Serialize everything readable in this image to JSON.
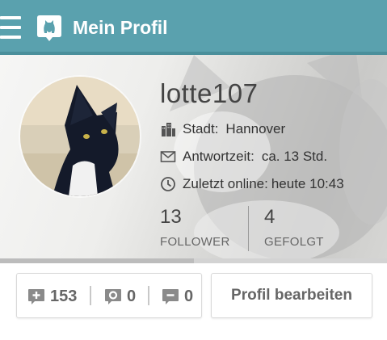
{
  "appbar": {
    "title": "Mein Profil",
    "background": "#5aa1ae",
    "menu_icon": "hamburger-menu-icon",
    "logo_icon": "app-logo-icon"
  },
  "profile": {
    "username": "lotte107",
    "city_label": "Stadt:",
    "city_value": "Hannover",
    "response_label": "Antwortzeit:",
    "response_value": "ca. 13 Std.",
    "last_online_label": "Zuletzt online:",
    "last_online_value": "heute 10:43",
    "followers_count": "13",
    "followers_label": "FOLLOWER",
    "following_count": "4",
    "following_label": "GEFOLGT"
  },
  "counts": {
    "plus": "153",
    "answers": "0",
    "messages": "0"
  },
  "actions": {
    "edit_profile": "Profil bearbeiten"
  }
}
